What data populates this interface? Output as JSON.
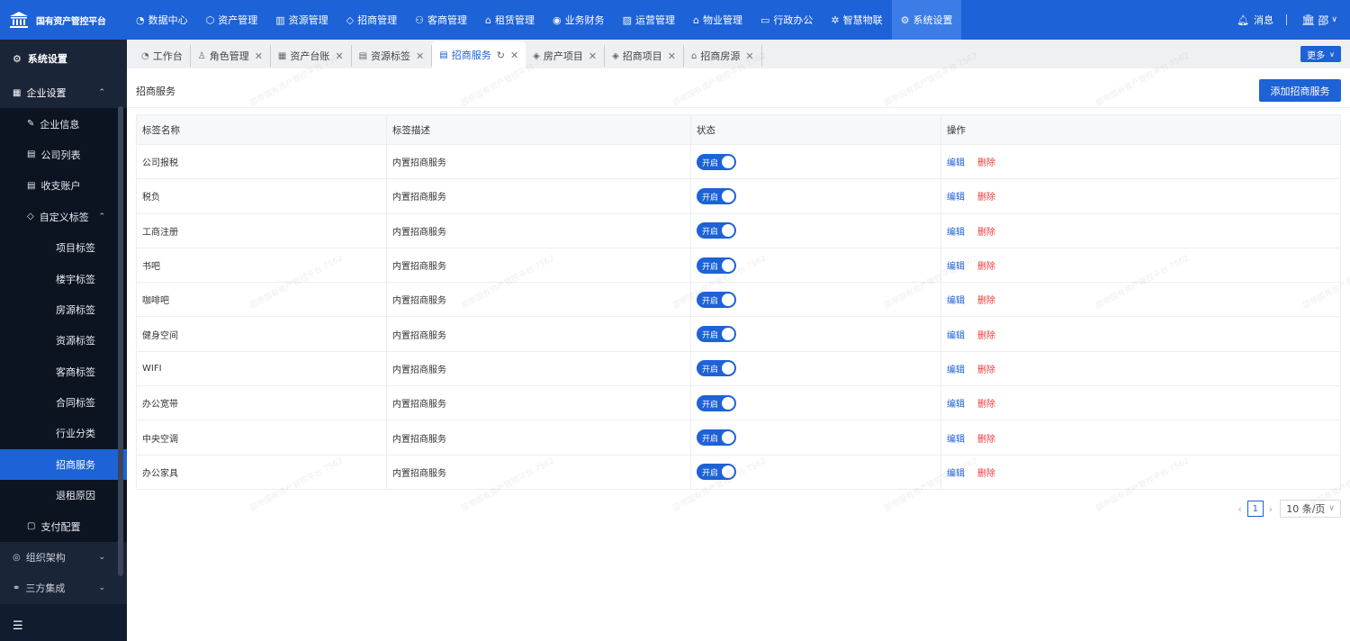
{
  "brand": {
    "title": "国有资产管控平台"
  },
  "top_menu": [
    {
      "label": "数据中心",
      "icon": "dashboard-icon"
    },
    {
      "label": "资产管理",
      "icon": "cube-icon"
    },
    {
      "label": "资源管理",
      "icon": "building-icon"
    },
    {
      "label": "招商管理",
      "icon": "tag-icon"
    },
    {
      "label": "客商管理",
      "icon": "users-icon"
    },
    {
      "label": "租赁管理",
      "icon": "home-icon"
    },
    {
      "label": "业务财务",
      "icon": "money-icon"
    },
    {
      "label": "运营管理",
      "icon": "chart-icon"
    },
    {
      "label": "物业管理",
      "icon": "house-icon"
    },
    {
      "label": "行政办公",
      "icon": "monitor-icon"
    },
    {
      "label": "智慧物联",
      "icon": "atom-icon"
    },
    {
      "label": "系统设置",
      "icon": "gear-icon",
      "active": true
    }
  ],
  "top_right": {
    "message_label": "消息",
    "user_name": "邵"
  },
  "sidebar": {
    "header": "系统设置",
    "enterprise": "企业设置",
    "items": [
      {
        "label": "企业信息",
        "level": 2
      },
      {
        "label": "公司列表",
        "level": 2
      },
      {
        "label": "收支账户",
        "level": 2
      },
      {
        "label": "自定义标签",
        "level": 2
      }
    ],
    "sub_items": [
      "项目标签",
      "楼宇标签",
      "房源标签",
      "资源标签",
      "客商标签",
      "合同标签",
      "行业分类",
      "招商服务",
      "退租原因"
    ],
    "active_sub": "招商服务",
    "after_items": [
      "支付配置"
    ],
    "groups": [
      "组织架构",
      "三方集成"
    ]
  },
  "tabs": [
    {
      "label": "工作台",
      "closable": false
    },
    {
      "label": "角色管理",
      "closable": true
    },
    {
      "label": "资产台账",
      "closable": true
    },
    {
      "label": "资源标签",
      "closable": true
    },
    {
      "label": "招商服务",
      "closable": true,
      "active": true
    },
    {
      "label": "房产项目",
      "closable": true
    },
    {
      "label": "招商项目",
      "closable": true
    },
    {
      "label": "招商房源",
      "closable": true
    }
  ],
  "more_label": "更多",
  "page": {
    "title": "招商服务",
    "add_button": "添加招商服务"
  },
  "table": {
    "columns": [
      "标签名称",
      "标签描述",
      "状态",
      "操作"
    ],
    "rows": [
      {
        "name": "公司报税",
        "desc": "内置招商服务",
        "status": "开启"
      },
      {
        "name": "税负",
        "desc": "内置招商服务",
        "status": "开启"
      },
      {
        "name": "工商注册",
        "desc": "内置招商服务",
        "status": "开启"
      },
      {
        "name": "书吧",
        "desc": "内置招商服务",
        "status": "开启"
      },
      {
        "name": "咖啡吧",
        "desc": "内置招商服务",
        "status": "开启"
      },
      {
        "name": "健身空间",
        "desc": "内置招商服务",
        "status": "开启"
      },
      {
        "name": "WIFI",
        "desc": "内置招商服务",
        "status": "开启"
      },
      {
        "name": "办公宽带",
        "desc": "内置招商服务",
        "status": "开启"
      },
      {
        "name": "中央空调",
        "desc": "内置招商服务",
        "status": "开启"
      },
      {
        "name": "办公家具",
        "desc": "内置招商服务",
        "status": "开启"
      }
    ],
    "edit_label": "编辑",
    "delete_label": "删除"
  },
  "pagination": {
    "current_page": "1",
    "page_size": "10 条/页"
  },
  "watermark": "邵帝国有资产管控平台 7562",
  "colors": {
    "primary": "#1d62d6",
    "sidebar_bg": "#111c2e",
    "danger": "#ee3b3b"
  }
}
